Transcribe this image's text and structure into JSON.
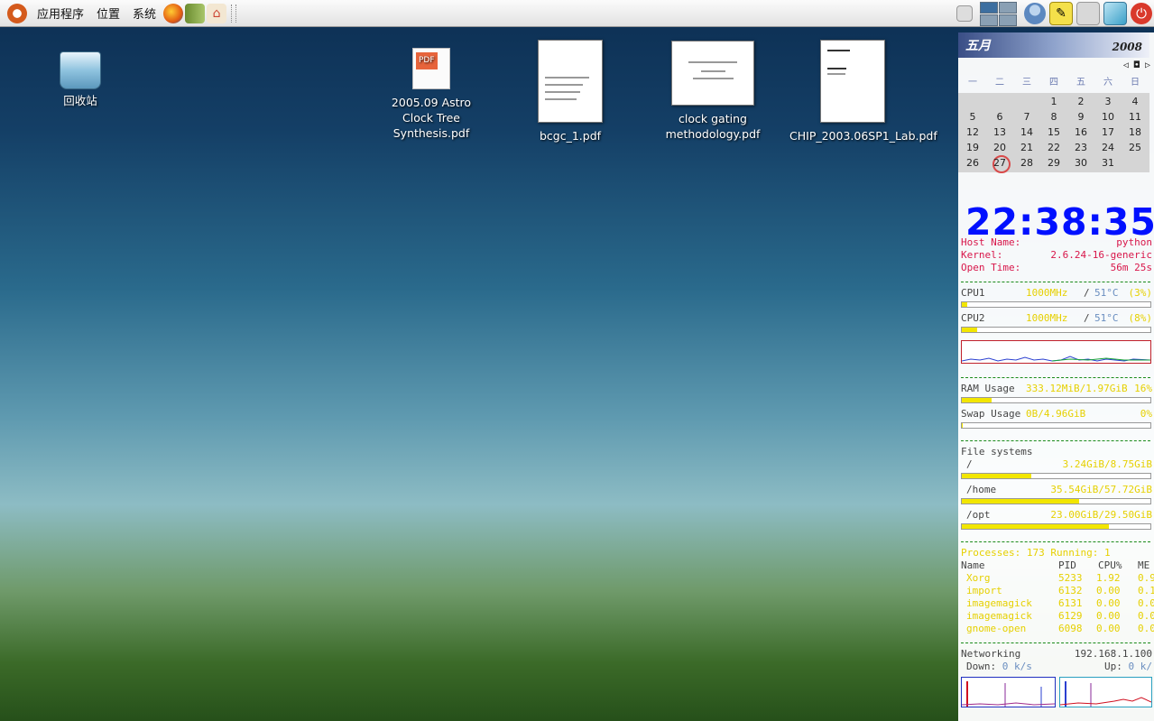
{
  "panel": {
    "menus": [
      "应用程序",
      "位置",
      "系统"
    ],
    "launchers": [
      "firefox-icon",
      "books-icon",
      "home-folder-icon"
    ]
  },
  "desktop": {
    "icons": [
      {
        "name": "trash",
        "label": "回收站"
      },
      {
        "name": "pdf-astro",
        "label": "2005.09 Astro Clock Tree Synthesis.pdf"
      },
      {
        "name": "pdf-bcgc",
        "label": "bcgc_1.pdf"
      },
      {
        "name": "pdf-clock",
        "label": "clock gating methodology.pdf"
      },
      {
        "name": "pdf-chip",
        "label": "CHIP_2003.06SP1_Lab.pdf"
      }
    ]
  },
  "calendar": {
    "month": "五月",
    "year": "2008",
    "weekdays": [
      "一",
      "二",
      "三",
      "四",
      "五",
      "六",
      "日"
    ],
    "weeks": [
      [
        "",
        "",
        "",
        "1",
        "2",
        "3",
        "4"
      ],
      [
        "5",
        "6",
        "7",
        "8",
        "9",
        "10",
        "11"
      ],
      [
        "12",
        "13",
        "14",
        "15",
        "16",
        "17",
        "18"
      ],
      [
        "19",
        "20",
        "21",
        "22",
        "23",
        "24",
        "25"
      ],
      [
        "26",
        "27",
        "28",
        "29",
        "30",
        "31",
        ""
      ]
    ],
    "today": "27"
  },
  "conky": {
    "time": "22:38:35",
    "host_label": "Host Name:",
    "host": "python",
    "kernel_label": "Kernel:",
    "kernel": "2.6.24-16-generic",
    "uptime_label": "Open Time:",
    "uptime": "56m 25s",
    "cpu": [
      {
        "label": "CPU1",
        "freq": "1000MHz",
        "sep": "/",
        "temp": "51°C",
        "pct": "(3%)",
        "usage": 0.03
      },
      {
        "label": "CPU2",
        "freq": "1000MHz",
        "sep": "/",
        "temp": "51°C",
        "pct": "(8%)",
        "usage": 0.08
      }
    ],
    "ram_label": "RAM Usage",
    "ram": "333.12MiB/1.97GiB",
    "ram_pct": "16%",
    "ram_usage": 0.16,
    "swap_label": "Swap Usage",
    "swap": "0B/4.96GiB",
    "swap_pct": "0%",
    "swap_usage": 0.0,
    "fs_title": "File systems",
    "filesystems": [
      {
        "mount": "/",
        "usage_text": "3.24GiB/8.75GiB",
        "usage": 0.37
      },
      {
        "mount": "/home",
        "usage_text": "35.54GiB/57.72GiB",
        "usage": 0.62
      },
      {
        "mount": "/opt",
        "usage_text": "23.00GiB/29.50GiB",
        "usage": 0.78
      }
    ],
    "processes_line": "Processes: 173  Running: 1",
    "proc_headers": [
      "Name",
      "PID",
      "CPU%",
      "ME"
    ],
    "processes": [
      [
        "Xorg",
        "5233",
        "1.92",
        "0.9"
      ],
      [
        "import",
        "6132",
        "0.00",
        "0.1"
      ],
      [
        "imagemagick",
        "6131",
        "0.00",
        "0.0"
      ],
      [
        "imagemagick",
        "6129",
        "0.00",
        "0.0"
      ],
      [
        "gnome-open",
        "6098",
        "0.00",
        "0.0"
      ]
    ],
    "net_label": "Networking",
    "net_ip": "192.168.1.100",
    "down_label": "Down:",
    "down": "0 k/s",
    "up_label": "Up:",
    "up": "0 k/"
  },
  "colors": {
    "conky_label": "#d8164a",
    "conky_value": "#e6d000",
    "clock": "#0010ff"
  }
}
